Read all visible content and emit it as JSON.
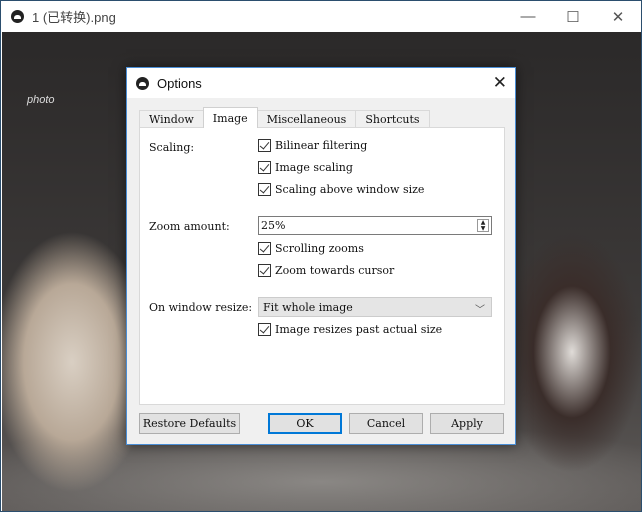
{
  "window": {
    "title": "1 (已转换).png",
    "minimize": "—",
    "maximize": "☐",
    "close": "✕"
  },
  "image": {
    "signature": "photo"
  },
  "dialog": {
    "title": "Options",
    "close": "✕",
    "tabs": [
      {
        "label": "Window"
      },
      {
        "label": "Image",
        "active": true
      },
      {
        "label": "Miscellaneous"
      },
      {
        "label": "Shortcuts"
      }
    ],
    "scaling_label": "Scaling:",
    "bilinear": {
      "label": "Bilinear filtering",
      "checked": true
    },
    "image_scaling": {
      "label": "Image scaling",
      "checked": true
    },
    "scaling_above": {
      "label": "Scaling above window size",
      "checked": true
    },
    "zoom_label": "Zoom amount:",
    "zoom_value": "25%",
    "scrolling_zooms": {
      "label": "Scrolling zooms",
      "checked": true
    },
    "zoom_towards": {
      "label": "Zoom towards cursor",
      "checked": true
    },
    "resize_label": "On window resize:",
    "resize_value": "Fit whole image",
    "resize_past": {
      "label": "Image resizes past actual size",
      "checked": true
    },
    "buttons": {
      "restore": "Restore Defaults",
      "ok": "OK",
      "cancel": "Cancel",
      "apply": "Apply"
    }
  },
  "colors": {
    "accent": "#0078d7",
    "dialog_border": "#4a8ed6"
  }
}
